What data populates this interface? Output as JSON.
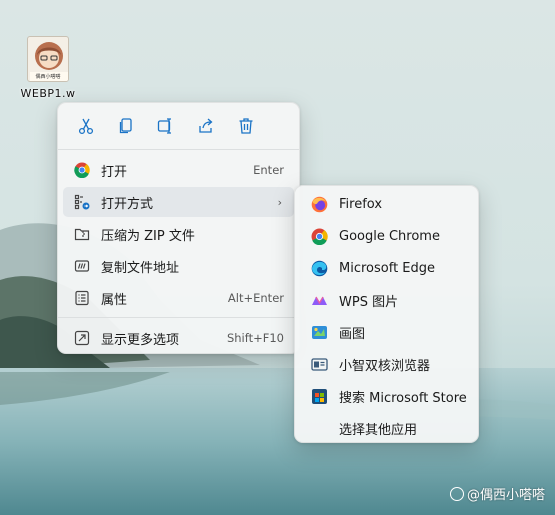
{
  "desktop": {
    "file_icon_text": "偶西小嗒嗒",
    "file_caption": "WEBP1.w"
  },
  "context_menu": {
    "toolbar": [
      {
        "icon": "cut-icon"
      },
      {
        "icon": "copy-icon"
      },
      {
        "icon": "rename-icon"
      },
      {
        "icon": "share-icon"
      },
      {
        "icon": "delete-icon"
      }
    ],
    "items": [
      {
        "label": "打开",
        "shortcut": "Enter",
        "icon": "chrome-icon"
      },
      {
        "label": "打开方式",
        "icon": "open-with-icon",
        "has_submenu": true,
        "chevron": "›"
      },
      {
        "label": "压缩为 ZIP 文件",
        "icon": "zip-folder-icon"
      },
      {
        "label": "复制文件地址",
        "icon": "copy-path-icon"
      },
      {
        "label": "属性",
        "shortcut": "Alt+Enter",
        "icon": "properties-icon"
      },
      {
        "label": "显示更多选项",
        "shortcut": "Shift+F10",
        "icon": "more-options-icon"
      }
    ]
  },
  "submenu": {
    "items": [
      {
        "label": "Firefox",
        "icon": "firefox-icon"
      },
      {
        "label": "Google Chrome",
        "icon": "chrome-icon"
      },
      {
        "label": "Microsoft Edge",
        "icon": "edge-icon"
      },
      {
        "label": "WPS 图片",
        "icon": "wps-pictures-icon"
      },
      {
        "label": "画图",
        "icon": "paint-icon"
      },
      {
        "label": "小智双核浏览器",
        "icon": "xiaozhi-browser-icon"
      },
      {
        "label": "搜索 Microsoft Store",
        "icon": "store-icon"
      },
      {
        "label": "选择其他应用",
        "icon": ""
      }
    ]
  },
  "watermark": {
    "text": "@偶西小嗒嗒"
  },
  "colors": {
    "accent": "#1a73c6",
    "menu_bg": "#f4f6f6",
    "highlight": "#e3e7ea"
  }
}
